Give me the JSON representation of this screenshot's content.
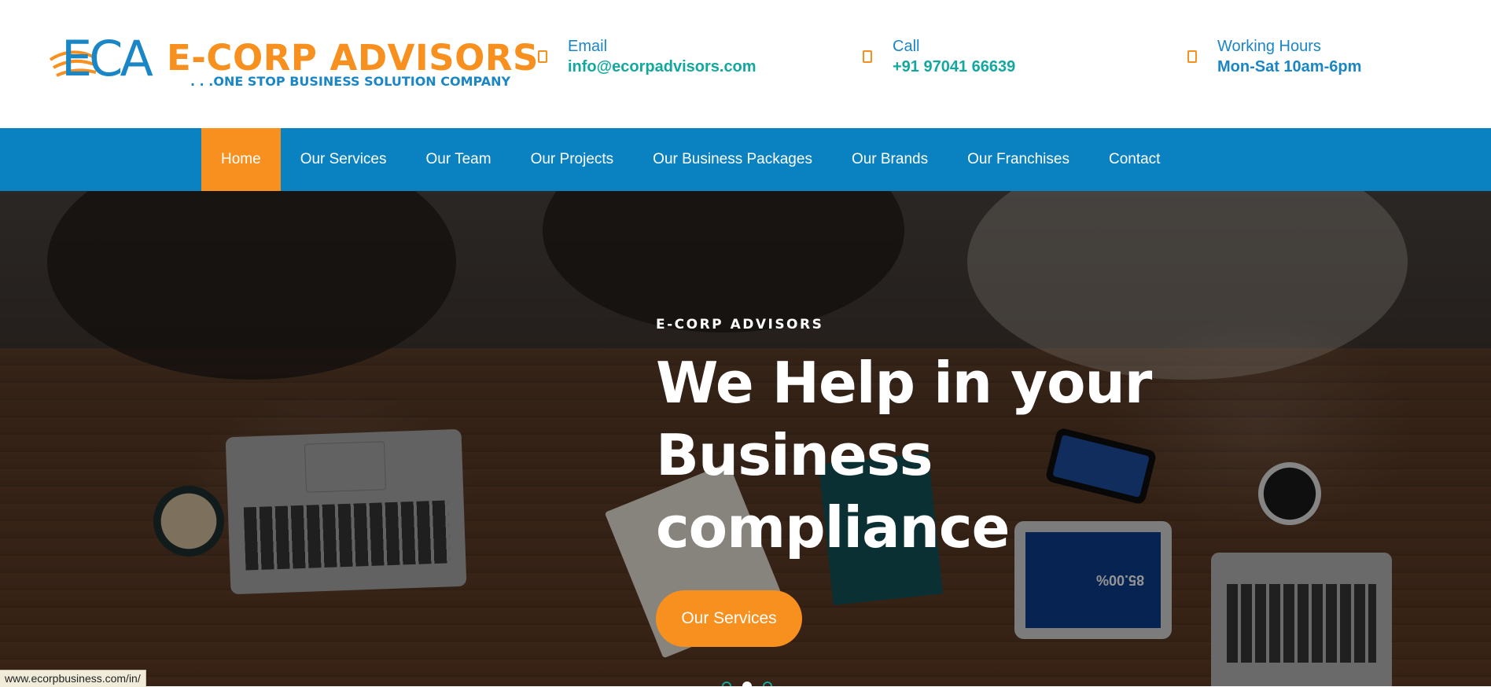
{
  "brand": {
    "mark": "ECA",
    "name": "E-CORP ADVISORS",
    "tagline": ". . .ONE STOP BUSINESS SOLUTION COMPANY",
    "colors": {
      "orange": "#f7901e",
      "blue": "#0a82c2",
      "teal": "#13a89e"
    }
  },
  "contacts": [
    {
      "icon": "envelope-icon",
      "label": "Email",
      "value": "info@ecorpadvisors.com"
    },
    {
      "icon": "phone-icon",
      "label": "Call",
      "value": "+91 97041 66639"
    },
    {
      "icon": "clock-icon",
      "label": "Working Hours",
      "value": "Mon-Sat 10am-6pm"
    }
  ],
  "nav": {
    "items": [
      {
        "label": "Home",
        "active": true
      },
      {
        "label": "Our Services"
      },
      {
        "label": "Our Team"
      },
      {
        "label": "Our Projects"
      },
      {
        "label": "Our Business Packages"
      },
      {
        "label": "Our Brands"
      },
      {
        "label": "Our Franchises"
      },
      {
        "label": "Contact"
      }
    ]
  },
  "hero": {
    "eyebrow": "E-CORP ADVISORS",
    "title_line1": "We Help in your",
    "title_line2": "Business",
    "title_line3": "compliance",
    "button": "Our Services",
    "tablet_text": "85.00%",
    "slides": 3,
    "active_slide": 2
  },
  "status": {
    "url": "www.ecorpbusiness.com/in/"
  }
}
